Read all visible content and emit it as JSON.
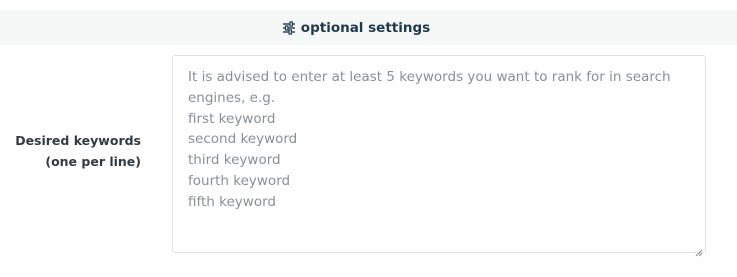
{
  "optional_settings": {
    "label": "optional settings",
    "icon": "sliders-icon"
  },
  "keywords_field": {
    "label_line1": "Desired keywords",
    "label_line2": "(one per line)",
    "value": "",
    "placeholder": "It is advised to enter at least 5 keywords you want to rank for in search\nengines, e.g.\nfirst keyword\nsecond keyword\nthird keyword\nfourth keyword\nfifth keyword"
  },
  "colors": {
    "toggle_text": "#22394d",
    "label_text": "#343a40",
    "placeholder_text": "#8a8f94",
    "bar_background": "#f6f7f7",
    "border": "#dfe2e5"
  }
}
